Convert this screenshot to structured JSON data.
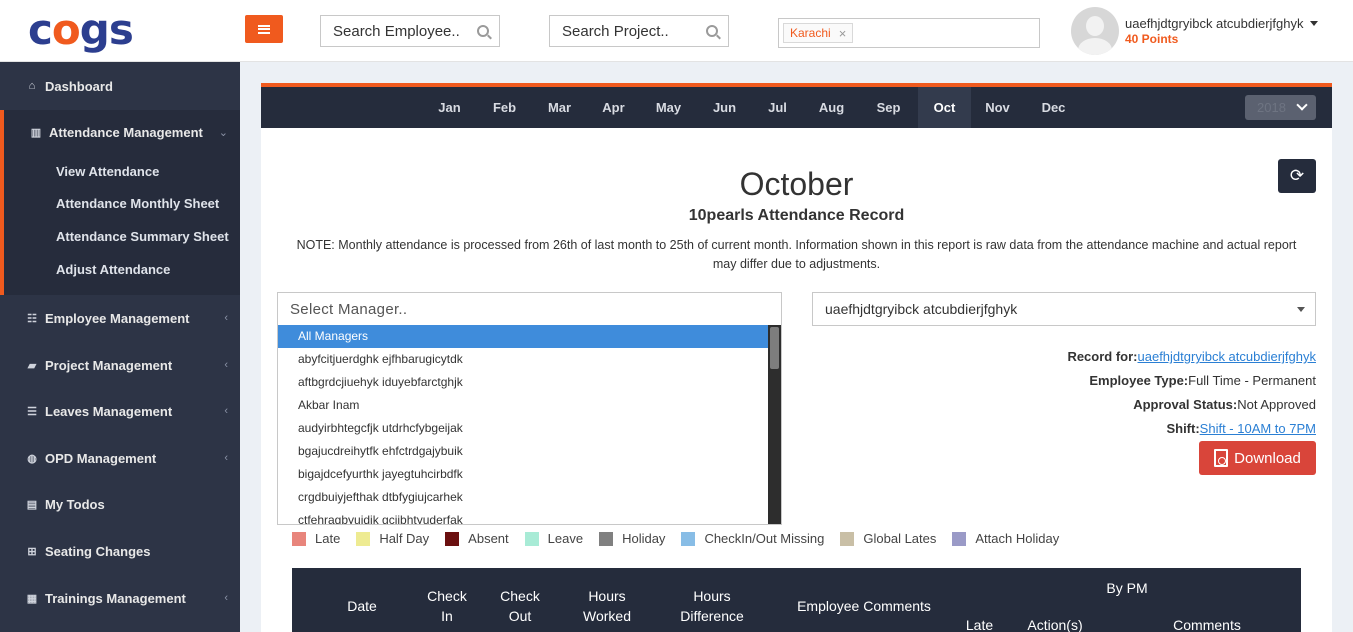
{
  "header": {
    "logo": "cogs",
    "search_employee": "Search Employee..",
    "search_project": "Search Project..",
    "location_tag": "Karachi",
    "tag_remove": "×",
    "user_name": "uaefhjdtgryibck atcubdierjfghyk",
    "points": "40 Points"
  },
  "sidebar": {
    "items": [
      {
        "label": "Dashboard",
        "icon": "home-icon"
      },
      {
        "label": "Attendance Management",
        "icon": "bar-chart-icon"
      },
      {
        "label": "Employee Management",
        "icon": "users-icon"
      },
      {
        "label": "Project Management",
        "icon": "folder-icon"
      },
      {
        "label": "Leaves Management",
        "icon": "leaves-icon"
      },
      {
        "label": "OPD Management",
        "icon": "globe-icon"
      },
      {
        "label": "My Todos",
        "icon": "book-icon"
      },
      {
        "label": "Seating Changes",
        "icon": "sitemap-icon"
      },
      {
        "label": "Trainings Management",
        "icon": "trainings-icon"
      }
    ],
    "sub_items": [
      "View Attendance",
      "Attendance Monthly Sheet",
      "Attendance Summary Sheet",
      "Adjust Attendance"
    ]
  },
  "months": [
    "Jan",
    "Feb",
    "Mar",
    "Apr",
    "May",
    "Jun",
    "Jul",
    "Aug",
    "Sep",
    "Oct",
    "Nov",
    "Dec"
  ],
  "active_month": "Oct",
  "year": "2018",
  "report": {
    "title": "October",
    "subtitle": "10pearls Attendance Record",
    "note": "NOTE: Monthly attendance is processed from 26th of last month to 25th of current month. Information shown in this report is raw data from the attendance machine and actual report may differ due to adjustments."
  },
  "manager_select": {
    "placeholder": "Select Manager..",
    "options": [
      "All Managers",
      "abyfcitjuerdghk ejfhbarugicytdk",
      "aftbgrdcjiuehyk iduyebfarctghjk",
      "Akbar Inam",
      "audyirbhtegcfjk utdrhcfybgeijak",
      "bgajucdreihytfk ehfctrdgajybuik",
      "bigajdcefyurthk jayegtuhcirbdfk",
      "crgdbuiyjefthak dtbfygiujcarhek",
      "ctfehragbyuidjk gciibhtyuderfak"
    ]
  },
  "employee_select": {
    "value": "uaefhjdtgryibck atcubdierjfghyk"
  },
  "record_info": {
    "record_for_label": "Record for:",
    "record_for_value": "uaefhjdtgryibck atcubdierjfghyk",
    "employee_type_label": "Employee Type:",
    "employee_type_value": "Full Time - Permanent",
    "approval_label": "Approval Status:",
    "approval_value": "Not Approved",
    "shift_label": "Shift:",
    "shift_value": "Shift - 10AM to 7PM"
  },
  "download_label": "Download",
  "legend": [
    {
      "label": "Late",
      "color": "#e8857c"
    },
    {
      "label": "Half Day",
      "color": "#eeeb92"
    },
    {
      "label": "Absent",
      "color": "#6b1010"
    },
    {
      "label": "Leave",
      "color": "#a8ebd6"
    },
    {
      "label": "Holiday",
      "color": "#808080"
    },
    {
      "label": "CheckIn/Out Missing",
      "color": "#88bde6"
    },
    {
      "label": "Global Lates",
      "color": "#c9bfa6"
    },
    {
      "label": "Attach Holiday",
      "color": "#9a9ac7"
    }
  ],
  "table": {
    "date": "Date",
    "check_in": "Check In",
    "check_out": "Check Out",
    "hours_worked": "Hours Worked",
    "hours_diff": "Hours Difference",
    "emp_comments": "Employee Comments",
    "by_pm": "By PM",
    "late": "Late",
    "actions": "Action(s)",
    "comments": "Comments"
  }
}
